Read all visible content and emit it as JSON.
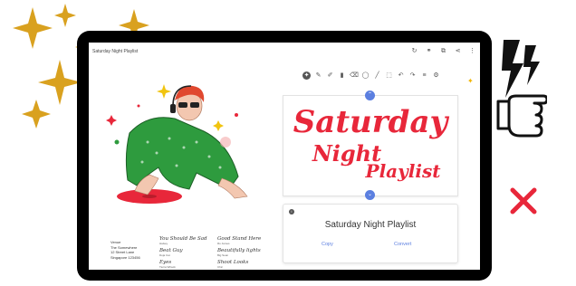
{
  "window": {
    "title": "Saturday Night Playlist",
    "top_icons": [
      "refresh-icon",
      "link-icon",
      "copy-icon",
      "share-icon",
      "more-icon"
    ]
  },
  "toolbar": {
    "tools": [
      "ai-icon",
      "pen-icon",
      "marker-icon",
      "highlighter-icon",
      "eraser-icon",
      "shape-icon",
      "line-icon",
      "select-icon",
      "undo-icon",
      "redo-icon",
      "layers-icon",
      "settings-icon"
    ]
  },
  "poster": {
    "address": [
      "Venue",
      "The Somewhere",
      "12 Street Lane",
      "Singapore 123456"
    ],
    "tracks": [
      {
        "title": "You Should Be Sad",
        "artist": "Halsey"
      },
      {
        "title": "Good Stand Here",
        "artist": "Ro James"
      },
      {
        "title": "Beat Guy",
        "artist": "Doja Cat"
      },
      {
        "title": "Beautifully lights",
        "artist": "Big Sean"
      },
      {
        "title": "Eyes",
        "artist": "Tierra Whack"
      },
      {
        "title": "Shoot Looks",
        "artist": "Chic"
      }
    ]
  },
  "canvas": {
    "lettering_line1": "Saturday",
    "lettering_line2": "Night",
    "lettering_line3": "Playlist"
  },
  "result": {
    "text": "Saturday Night Playlist",
    "copy_label": "Copy",
    "convert_label": "Convert"
  },
  "colors": {
    "gold": "#d9a11f",
    "red": "#e8273a",
    "green": "#2e9b3e",
    "accent_blue": "#5b7fe0",
    "device": "#000000"
  },
  "decorations": [
    "sparkle-icons",
    "lightning-bolt-icon",
    "pointing-hand-icon",
    "red-x-icon"
  ]
}
